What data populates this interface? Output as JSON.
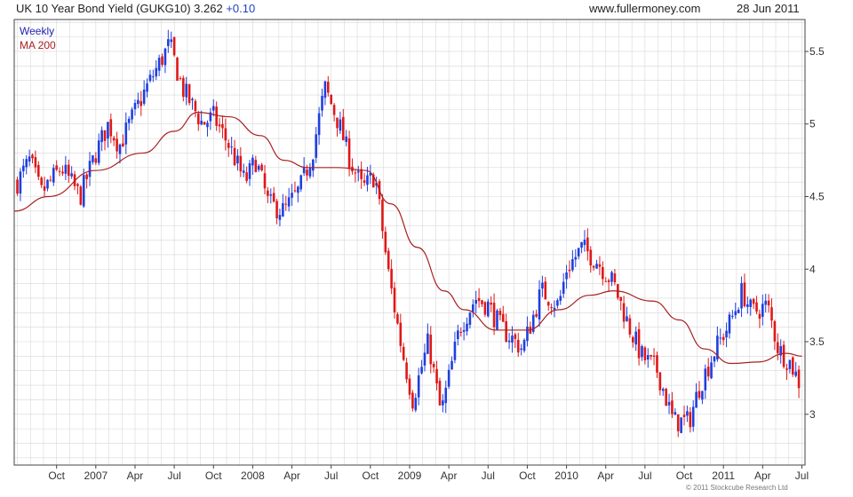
{
  "header": {
    "title": "UK 10 Year Bond Yield (GUKG10) 3.262",
    "change": "+0.10",
    "site": "www.fullermoney.com",
    "date": "28 Jun 2011"
  },
  "legend": {
    "weekly": "Weekly",
    "ma": "MA 200"
  },
  "copyright": "© 2011 Stockcube Research Ltd",
  "colors": {
    "up": "#1f3fe0",
    "down": "#e01818",
    "ma": "#a82020",
    "grid": "#d8d8d8"
  },
  "chart_data": {
    "type": "candlestick",
    "y_axis_position": "right",
    "ylim": [
      2.65,
      5.72
    ],
    "y_ticks": [
      3,
      3.5,
      4,
      4.5,
      5,
      5.5
    ],
    "y_tick_labels": [
      "3",
      "3.5",
      "4",
      "4.5",
      "5",
      "5.5"
    ],
    "x_labels": [
      {
        "label": "Oct",
        "t": 2006.75
      },
      {
        "label": "2007",
        "t": 2007.0
      },
      {
        "label": "Apr",
        "t": 2007.25
      },
      {
        "label": "Jul",
        "t": 2007.5
      },
      {
        "label": "Oct",
        "t": 2007.75
      },
      {
        "label": "2008",
        "t": 2008.0
      },
      {
        "label": "Apr",
        "t": 2008.25
      },
      {
        "label": "Jul",
        "t": 2008.5
      },
      {
        "label": "Oct",
        "t": 2008.75
      },
      {
        "label": "2009",
        "t": 2009.0
      },
      {
        "label": "Apr",
        "t": 2009.25
      },
      {
        "label": "Jul",
        "t": 2009.5
      },
      {
        "label": "Oct",
        "t": 2009.75
      },
      {
        "label": "2010",
        "t": 2010.0
      },
      {
        "label": "Apr",
        "t": 2010.25
      },
      {
        "label": "Jul",
        "t": 2010.5
      },
      {
        "label": "Oct",
        "t": 2010.75
      },
      {
        "label": "2011",
        "t": 2011.0
      },
      {
        "label": "Apr",
        "t": 2011.25
      },
      {
        "label": "Jul",
        "t": 2011.5
      }
    ],
    "xlim": [
      2006.48,
      2011.52
    ],
    "price_anchors": [
      {
        "t": 2006.5,
        "v": 4.6
      },
      {
        "t": 2006.58,
        "v": 4.75
      },
      {
        "t": 2006.65,
        "v": 4.52
      },
      {
        "t": 2006.78,
        "v": 4.7
      },
      {
        "t": 2006.9,
        "v": 4.5
      },
      {
        "t": 2007.0,
        "v": 4.8
      },
      {
        "t": 2007.08,
        "v": 5.0
      },
      {
        "t": 2007.15,
        "v": 4.85
      },
      {
        "t": 2007.3,
        "v": 5.2
      },
      {
        "t": 2007.42,
        "v": 5.45
      },
      {
        "t": 2007.47,
        "v": 5.55
      },
      {
        "t": 2007.55,
        "v": 5.25
      },
      {
        "t": 2007.68,
        "v": 5.0
      },
      {
        "t": 2007.75,
        "v": 5.05
      },
      {
        "t": 2007.85,
        "v": 4.85
      },
      {
        "t": 2007.95,
        "v": 4.6
      },
      {
        "t": 2008.02,
        "v": 4.75
      },
      {
        "t": 2008.1,
        "v": 4.45
      },
      {
        "t": 2008.2,
        "v": 4.4
      },
      {
        "t": 2008.3,
        "v": 4.55
      },
      {
        "t": 2008.38,
        "v": 4.8
      },
      {
        "t": 2008.46,
        "v": 5.25
      },
      {
        "t": 2008.55,
        "v": 5.0
      },
      {
        "t": 2008.62,
        "v": 4.75
      },
      {
        "t": 2008.7,
        "v": 4.55
      },
      {
        "t": 2008.78,
        "v": 4.65
      },
      {
        "t": 2008.86,
        "v": 4.0
      },
      {
        "t": 2008.95,
        "v": 3.45
      },
      {
        "t": 2009.02,
        "v": 3.1
      },
      {
        "t": 2009.12,
        "v": 3.5
      },
      {
        "t": 2009.2,
        "v": 3.0
      },
      {
        "t": 2009.32,
        "v": 3.6
      },
      {
        "t": 2009.42,
        "v": 3.8
      },
      {
        "t": 2009.5,
        "v": 3.75
      },
      {
        "t": 2009.58,
        "v": 3.6
      },
      {
        "t": 2009.72,
        "v": 3.45
      },
      {
        "t": 2009.84,
        "v": 3.85
      },
      {
        "t": 2009.95,
        "v": 3.75
      },
      {
        "t": 2010.0,
        "v": 4.0
      },
      {
        "t": 2010.1,
        "v": 4.15
      },
      {
        "t": 2010.2,
        "v": 4.05
      },
      {
        "t": 2010.3,
        "v": 3.9
      },
      {
        "t": 2010.4,
        "v": 3.6
      },
      {
        "t": 2010.48,
        "v": 3.4
      },
      {
        "t": 2010.58,
        "v": 3.3
      },
      {
        "t": 2010.68,
        "v": 2.95
      },
      {
        "t": 2010.78,
        "v": 2.95
      },
      {
        "t": 2010.85,
        "v": 3.2
      },
      {
        "t": 2010.95,
        "v": 3.45
      },
      {
        "t": 2011.05,
        "v": 3.65
      },
      {
        "t": 2011.12,
        "v": 3.85
      },
      {
        "t": 2011.18,
        "v": 3.7
      },
      {
        "t": 2011.28,
        "v": 3.75
      },
      {
        "t": 2011.35,
        "v": 3.45
      },
      {
        "t": 2011.43,
        "v": 3.35
      },
      {
        "t": 2011.49,
        "v": 3.2
      }
    ],
    "ma200": [
      {
        "t": 2006.48,
        "v": 4.4
      },
      {
        "t": 2006.7,
        "v": 4.5
      },
      {
        "t": 2007.0,
        "v": 4.68
      },
      {
        "t": 2007.3,
        "v": 4.8
      },
      {
        "t": 2007.5,
        "v": 4.95
      },
      {
        "t": 2007.65,
        "v": 5.08
      },
      {
        "t": 2007.85,
        "v": 5.05
      },
      {
        "t": 2008.05,
        "v": 4.92
      },
      {
        "t": 2008.2,
        "v": 4.75
      },
      {
        "t": 2008.35,
        "v": 4.7
      },
      {
        "t": 2008.55,
        "v": 4.7
      },
      {
        "t": 2008.72,
        "v": 4.68
      },
      {
        "t": 2008.88,
        "v": 4.45
      },
      {
        "t": 2009.05,
        "v": 4.15
      },
      {
        "t": 2009.22,
        "v": 3.85
      },
      {
        "t": 2009.35,
        "v": 3.72
      },
      {
        "t": 2009.55,
        "v": 3.58
      },
      {
        "t": 2009.75,
        "v": 3.58
      },
      {
        "t": 2009.95,
        "v": 3.72
      },
      {
        "t": 2010.15,
        "v": 3.82
      },
      {
        "t": 2010.3,
        "v": 3.85
      },
      {
        "t": 2010.55,
        "v": 3.78
      },
      {
        "t": 2010.72,
        "v": 3.65
      },
      {
        "t": 2010.88,
        "v": 3.45
      },
      {
        "t": 2011.05,
        "v": 3.35
      },
      {
        "t": 2011.22,
        "v": 3.36
      },
      {
        "t": 2011.4,
        "v": 3.42
      },
      {
        "t": 2011.5,
        "v": 3.4
      }
    ]
  }
}
